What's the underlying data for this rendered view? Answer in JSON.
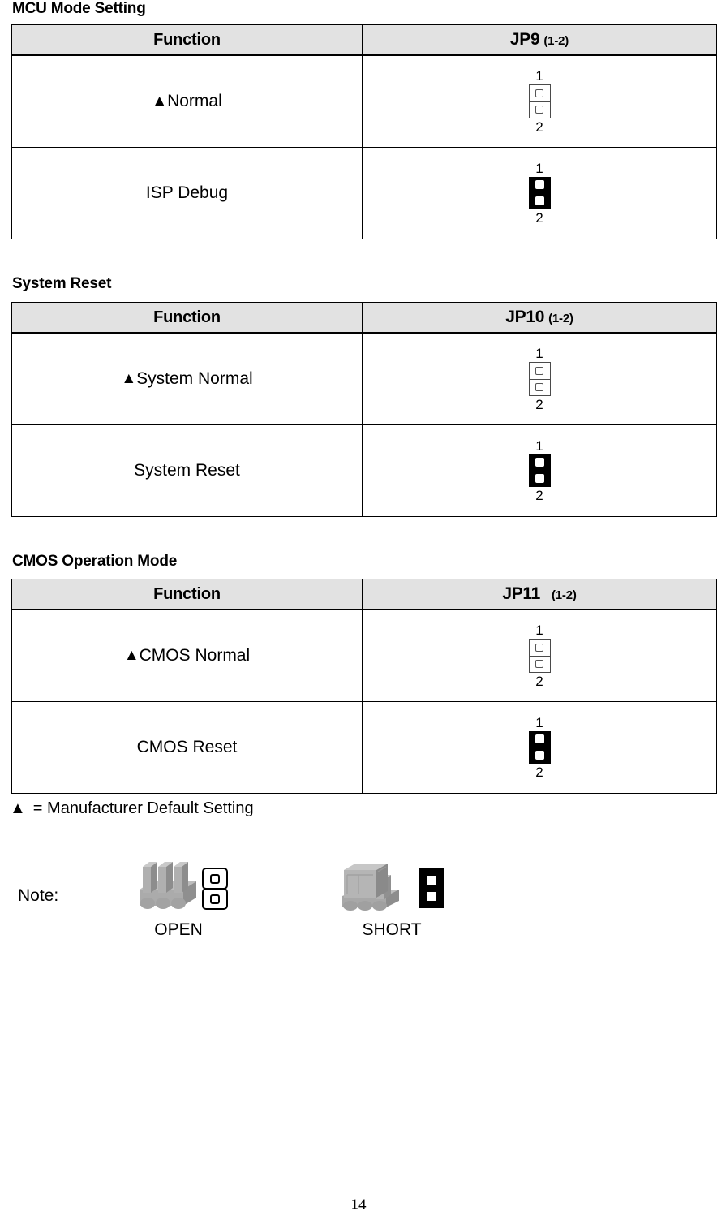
{
  "page": {
    "number": "14"
  },
  "sections": [
    {
      "heading": "MCU Mode Setting",
      "columns": {
        "function": "Function",
        "jumper_main": "JP9",
        "jumper_sub": "(1-2)"
      },
      "jumper_gap": "narrow",
      "rows": [
        {
          "marker": "▲",
          "label": "Normal",
          "pin_top": "1",
          "pin_bottom": "2",
          "state": "open"
        },
        {
          "marker": "",
          "label": "ISP Debug",
          "pin_top": "1",
          "pin_bottom": "2",
          "state": "short"
        }
      ]
    },
    {
      "heading": "System Reset",
      "columns": {
        "function": "Function",
        "jumper_main": "JP10",
        "jumper_sub": "(1-2)"
      },
      "jumper_gap": "narrow",
      "rows": [
        {
          "marker": "▲",
          "label": "System Normal",
          "pin_top": "1",
          "pin_bottom": "2",
          "state": "open"
        },
        {
          "marker": "",
          "label": "System Reset",
          "pin_top": "1",
          "pin_bottom": "2",
          "state": "short"
        }
      ]
    },
    {
      "heading": "CMOS Operation Mode",
      "columns": {
        "function": "Function",
        "jumper_main": "JP11",
        "jumper_sub": "(1-2)"
      },
      "jumper_gap": "wide",
      "rows": [
        {
          "marker": "▲",
          "label": "CMOS Normal",
          "pin_top": "1",
          "pin_bottom": "2",
          "state": "open"
        },
        {
          "marker": "",
          "label": "CMOS Reset",
          "pin_top": "1",
          "pin_bottom": "2",
          "state": "short"
        }
      ]
    }
  ],
  "footnote": {
    "marker": "▲",
    "text": "= Manufacturer Default Setting"
  },
  "note": {
    "label": "Note:",
    "open_caption": "OPEN",
    "short_caption": "SHORT"
  },
  "colors": {
    "header_fill": "#e2e2e2",
    "border": "#000000",
    "short_fill": "#000000",
    "pin_body": "#a6a6a6",
    "pin_shade": "#8c8c8c",
    "pin_light": "#bfbfbf"
  }
}
